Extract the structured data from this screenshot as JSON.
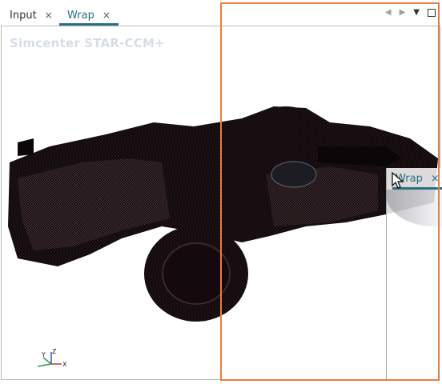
{
  "tabs": [
    {
      "label": "Input",
      "close": "×",
      "active": false
    },
    {
      "label": "Wrap",
      "close": "×",
      "active": true
    }
  ],
  "view_controls": {
    "prev_icon": "◀",
    "next_icon": "▶",
    "menu_icon": "▼",
    "maximize_icon": "maximize-square"
  },
  "viewport": {
    "watermark": "Simcenter STAR-CCM+",
    "axes": {
      "x": "X",
      "y": "Y",
      "z": "Z"
    }
  },
  "drag_preview": {
    "label": "Wrap",
    "close": "×"
  },
  "colors": {
    "accent": "#2a6f86",
    "drop_highlight": "#ee7b3f",
    "watermark": "#d6dde6"
  }
}
